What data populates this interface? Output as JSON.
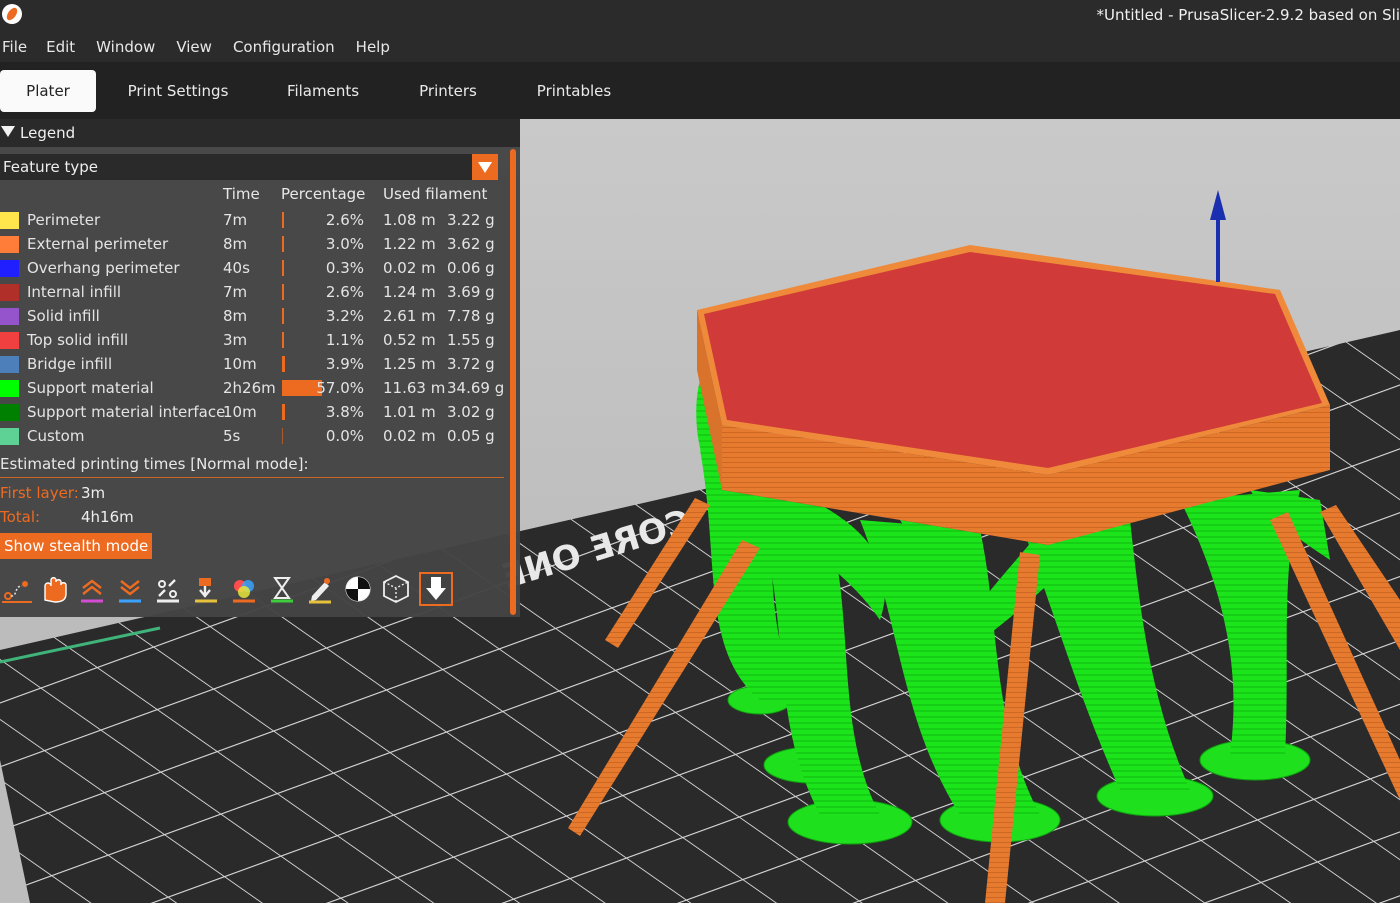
{
  "window": {
    "title": "*Untitled - PrusaSlicer-2.9.2 based on Sli"
  },
  "menu": [
    "File",
    "Edit",
    "Window",
    "View",
    "Configuration",
    "Help"
  ],
  "tabs": [
    {
      "label": "Plater",
      "active": true
    },
    {
      "label": "Print Settings",
      "active": false
    },
    {
      "label": "Filaments",
      "active": false
    },
    {
      "label": "Printers",
      "active": false
    },
    {
      "label": "Printables",
      "active": false
    }
  ],
  "legend": {
    "title": "Legend",
    "view_type": "Feature type",
    "columns": {
      "time": "Time",
      "percentage": "Percentage",
      "used_filament": "Used filament"
    },
    "rows": [
      {
        "feature": "Perimeter",
        "color": "#ffe64d",
        "time": "7m",
        "percent": "2.6%",
        "percent_value": 2.6,
        "meters": "1.08 m",
        "grams": "3.22 g"
      },
      {
        "feature": "External perimeter",
        "color": "#ff7d38",
        "time": "8m",
        "percent": "3.0%",
        "percent_value": 3.0,
        "meters": "1.22 m",
        "grams": "3.62 g"
      },
      {
        "feature": "Overhang perimeter",
        "color": "#1f1fff",
        "time": "40s",
        "percent": "0.3%",
        "percent_value": 0.3,
        "meters": "0.02 m",
        "grams": "0.06 g"
      },
      {
        "feature": "Internal infill",
        "color": "#b03029",
        "time": "7m",
        "percent": "2.6%",
        "percent_value": 2.6,
        "meters": "1.24 m",
        "grams": "3.69 g"
      },
      {
        "feature": "Solid infill",
        "color": "#9654cc",
        "time": "8m",
        "percent": "3.2%",
        "percent_value": 3.2,
        "meters": "2.61 m",
        "grams": "7.78 g"
      },
      {
        "feature": "Top solid infill",
        "color": "#f04040",
        "time": "3m",
        "percent": "1.1%",
        "percent_value": 1.1,
        "meters": "0.52 m",
        "grams": "1.55 g"
      },
      {
        "feature": "Bridge infill",
        "color": "#4d80ba",
        "time": "10m",
        "percent": "3.9%",
        "percent_value": 3.9,
        "meters": "1.25 m",
        "grams": "3.72 g"
      },
      {
        "feature": "Support material",
        "color": "#00ff00",
        "time": "2h26m",
        "percent": "57.0%",
        "percent_value": 57.0,
        "meters": "11.63 m",
        "grams": "34.69 g"
      },
      {
        "feature": "Support material interface",
        "color": "#008000",
        "time": "10m",
        "percent": "3.8%",
        "percent_value": 3.8,
        "meters": "1.01 m",
        "grams": "3.02 g"
      },
      {
        "feature": "Custom",
        "color": "#5ed194",
        "time": "5s",
        "percent": "0.0%",
        "percent_value": 0.0,
        "meters": "0.02 m",
        "grams": "0.05 g"
      }
    ],
    "estimated_label": "Estimated printing times [Normal mode]:",
    "first_layer_label": "First layer:",
    "first_layer_value": "3m",
    "total_label": "Total:",
    "total_value": "4h16m",
    "stealth_button": "Show stealth mode"
  },
  "toolbar_icons": [
    "travel-icon",
    "wipe-icon",
    "retractions-icon",
    "deretractions-icon",
    "seams-icon",
    "tool-changes-icon",
    "color-changes-icon",
    "pause-prints-icon",
    "custom-gcodes-icon",
    "center-of-gravity-icon",
    "shells-icon",
    "tool-marker-icon"
  ],
  "bed_logo_text": "CORE ONE",
  "colors": {
    "accent": "#ed6b21"
  }
}
